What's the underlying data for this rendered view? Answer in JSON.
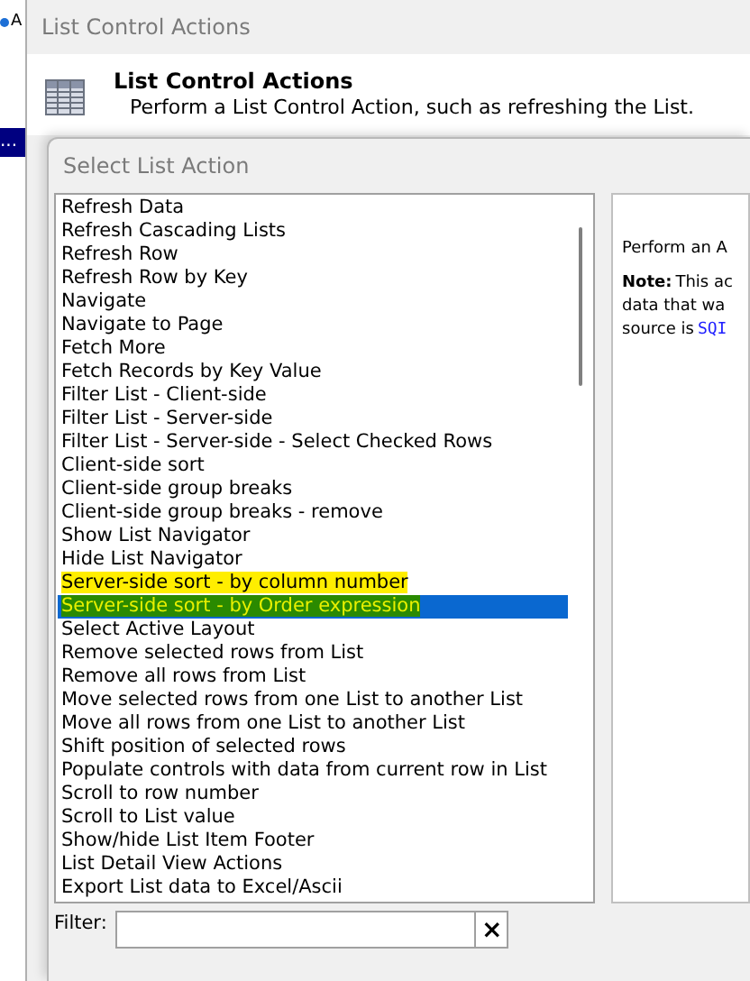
{
  "background_app": {
    "tab_label": "A",
    "selected_item": "..."
  },
  "window": {
    "title": "List Control Actions"
  },
  "header": {
    "title": "List Control Actions",
    "description": "Perform a List Control Action, such as refreshing the List."
  },
  "dialog": {
    "title": "Select List Action"
  },
  "actions": [
    {
      "label": "Refresh Data",
      "selected": false,
      "highlighted": false
    },
    {
      "label": "Refresh Cascading Lists",
      "selected": false,
      "highlighted": false
    },
    {
      "label": "Refresh Row",
      "selected": false,
      "highlighted": false
    },
    {
      "label": "Refresh Row by Key",
      "selected": false,
      "highlighted": false
    },
    {
      "label": "Navigate",
      "selected": false,
      "highlighted": false
    },
    {
      "label": "Navigate to Page",
      "selected": false,
      "highlighted": false
    },
    {
      "label": "Fetch More",
      "selected": false,
      "highlighted": false
    },
    {
      "label": "Fetch Records by Key Value",
      "selected": false,
      "highlighted": false
    },
    {
      "label": "Filter List - Client-side",
      "selected": false,
      "highlighted": false
    },
    {
      "label": "Filter List - Server-side",
      "selected": false,
      "highlighted": false
    },
    {
      "label": "Filter List - Server-side - Select Checked Rows",
      "selected": false,
      "highlighted": false
    },
    {
      "label": "Client-side sort",
      "selected": false,
      "highlighted": false
    },
    {
      "label": "Client-side group breaks",
      "selected": false,
      "highlighted": false
    },
    {
      "label": "Client-side group breaks - remove",
      "selected": false,
      "highlighted": false
    },
    {
      "label": "Show List Navigator",
      "selected": false,
      "highlighted": false
    },
    {
      "label": "Hide List Navigator",
      "selected": false,
      "highlighted": false
    },
    {
      "label": "Server-side sort - by column number",
      "selected": false,
      "highlighted": true
    },
    {
      "label": "Server-side sort - by Order expression",
      "selected": true,
      "highlighted": true
    },
    {
      "label": "Select Active Layout",
      "selected": false,
      "highlighted": false
    },
    {
      "label": "Remove selected rows from List",
      "selected": false,
      "highlighted": false
    },
    {
      "label": "Remove all rows from List",
      "selected": false,
      "highlighted": false
    },
    {
      "label": "Move selected rows from one List to another List",
      "selected": false,
      "highlighted": false
    },
    {
      "label": "Move all rows from one List to another List",
      "selected": false,
      "highlighted": false
    },
    {
      "label": "Shift position of selected rows",
      "selected": false,
      "highlighted": false
    },
    {
      "label": "Populate controls with data from current row in List",
      "selected": false,
      "highlighted": false
    },
    {
      "label": "Scroll to row number",
      "selected": false,
      "highlighted": false
    },
    {
      "label": "Scroll to List value",
      "selected": false,
      "highlighted": false
    },
    {
      "label": "Show/hide List Item Footer",
      "selected": false,
      "highlighted": false
    },
    {
      "label": "List Detail View Actions",
      "selected": false,
      "highlighted": false
    },
    {
      "label": "Export List data to Excel/Ascii",
      "selected": false,
      "highlighted": false
    }
  ],
  "description_panel": {
    "summary": "Perform an A",
    "note_label": "Note:",
    "note_lines": [
      "This ac",
      "data that wa",
      "source is"
    ],
    "note_link": "SQI"
  },
  "filter": {
    "label": "Filter:",
    "clear_button": "×"
  }
}
